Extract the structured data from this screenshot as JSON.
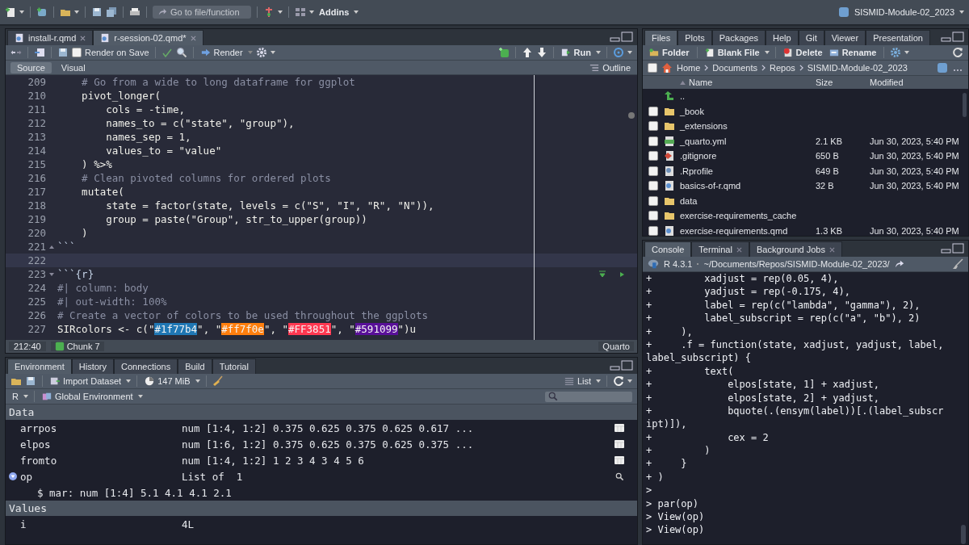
{
  "toolbar": {
    "goto_placeholder": "Go to file/function",
    "addins": "Addins",
    "project": "SISMID-Module-02_2023"
  },
  "editor": {
    "tabs": [
      {
        "label": "install-r.qmd",
        "selected": false
      },
      {
        "label": "r-session-02.qmd*",
        "selected": true
      }
    ],
    "render_on_save": {
      "label": "Render on Save",
      "checked": false
    },
    "render": "Render",
    "run": "Run",
    "modes": [
      {
        "label": "Source",
        "selected": true
      },
      {
        "label": "Visual",
        "selected": false
      }
    ],
    "outline": "Outline",
    "lines": [
      {
        "number": "209",
        "kind": "comment",
        "text": "    # Go from a wide to long dataframe for ggplot",
        "highlighted": false
      },
      {
        "number": "210",
        "kind": "code",
        "text": "    pivot_longer(",
        "highlighted": false
      },
      {
        "number": "211",
        "kind": "code",
        "text": "        cols = -time,",
        "highlighted": false
      },
      {
        "number": "212",
        "kind": "code",
        "text": "        names_to = c(\"state\", \"group\"),",
        "highlighted": false
      },
      {
        "number": "213",
        "kind": "code",
        "text": "        names_sep = 1,",
        "highlighted": false
      },
      {
        "number": "214",
        "kind": "code",
        "text": "        values_to = \"value\"",
        "highlighted": false
      },
      {
        "number": "215",
        "kind": "code",
        "text": "    ) %>%",
        "highlighted": false
      },
      {
        "number": "216",
        "kind": "comment",
        "text": "    # Clean pivoted columns for ordered plots",
        "highlighted": false
      },
      {
        "number": "217",
        "kind": "code",
        "text": "    mutate(",
        "highlighted": false
      },
      {
        "number": "218",
        "kind": "code",
        "text": "        state = factor(state, levels = c(\"S\", \"I\", \"R\", \"N\")),",
        "highlighted": false
      },
      {
        "number": "219",
        "kind": "code",
        "text": "        group = paste(\"Group\", str_to_upper(group))",
        "highlighted": false
      },
      {
        "number": "220",
        "kind": "code",
        "text": "    )",
        "highlighted": false
      },
      {
        "number": "221",
        "kind": "fence-close",
        "text": "```",
        "highlighted": false
      },
      {
        "number": "222",
        "kind": "blank",
        "highlighted": true
      },
      {
        "number": "223",
        "kind": "fence-open",
        "text": "```{r}",
        "highlighted": false
      },
      {
        "number": "224",
        "kind": "comment",
        "text": "#| column: body",
        "highlighted": false
      },
      {
        "number": "225",
        "kind": "comment",
        "text": "#| out-width: 100%",
        "highlighted": false
      },
      {
        "number": "226",
        "kind": "comment",
        "text": "# Create a vector of colors to be used throughout the ggplots",
        "highlighted": false
      },
      {
        "number": "227",
        "kind": "code",
        "segments": [
          {
            "text": "SIRcolors <- c(\""
          },
          {
            "text": "#1f77b4",
            "color": "#1f77b4"
          },
          {
            "text": "\", \""
          },
          {
            "text": "#ff7f0e",
            "color": "#ff7f0e"
          },
          {
            "text": "\", \""
          },
          {
            "text": "#FF3851",
            "color": "#ff3851"
          },
          {
            "text": "\", \""
          },
          {
            "text": "#591099",
            "color": "#591099"
          },
          {
            "text": "\")u"
          }
        ],
        "highlighted": false
      }
    ],
    "status": {
      "position": "212:40",
      "chunk": "Chunk 7",
      "type": "Quarto"
    }
  },
  "environment": {
    "tabs": [
      {
        "label": "Environment",
        "selected": true
      },
      {
        "label": "History",
        "selected": false
      },
      {
        "label": "Connections",
        "selected": false
      },
      {
        "label": "Build",
        "selected": false
      },
      {
        "label": "Tutorial",
        "selected": false
      }
    ],
    "import": "Import Dataset",
    "memory": "147 MiB",
    "view": "List",
    "language": "R",
    "scope": "Global Environment",
    "sections": [
      {
        "title": "Data",
        "rows": [
          {
            "name": "arrpos",
            "value": "num [1:4, 1:2] 0.375 0.625 0.375 0.625 0.617 ...",
            "kind": "grid"
          },
          {
            "name": "elpos",
            "value": "num [1:6, 1:2] 0.375 0.625 0.375 0.625 0.375 ...",
            "kind": "grid"
          },
          {
            "name": "fromto",
            "value": "num [1:4, 1:2] 1 2 3 4 3 4 5 6",
            "kind": "grid"
          },
          {
            "name": "op",
            "value": "List of  1",
            "kind": "list",
            "expanded": true,
            "children": [
              "$ mar: num [1:4] 5.1 4.1 4.1 2.1"
            ]
          }
        ]
      },
      {
        "title": "Values",
        "rows": [
          {
            "name": "i",
            "value": "4L",
            "kind": "value"
          }
        ]
      }
    ]
  },
  "files": {
    "tabs": [
      {
        "label": "Files",
        "selected": true
      },
      {
        "label": "Plots",
        "selected": false
      },
      {
        "label": "Packages",
        "selected": false
      },
      {
        "label": "Help",
        "selected": false
      },
      {
        "label": "Git",
        "selected": false
      },
      {
        "label": "Viewer",
        "selected": false
      },
      {
        "label": "Presentation",
        "selected": false
      }
    ],
    "actions": [
      {
        "kind": "folder",
        "label": "Folder"
      },
      {
        "kind": "file",
        "label": "Blank File"
      },
      {
        "kind": "delete",
        "label": "Delete"
      },
      {
        "kind": "rename",
        "label": "Rename"
      }
    ],
    "select_all": {
      "checked": false
    },
    "path": [
      "Home",
      "Documents",
      "Repos",
      "SISMID-Module-02_2023"
    ],
    "columns": [
      "Name",
      "Size",
      "Modified"
    ],
    "rows": [
      {
        "kind": "up",
        "name": ".."
      },
      {
        "kind": "folder",
        "name": "_book",
        "checked": false
      },
      {
        "kind": "folder",
        "name": "_extensions",
        "checked": false
      },
      {
        "kind": "yml",
        "name": "_quarto.yml",
        "size": "2.1 KB",
        "modified": "Jun 30, 2023, 5:40 PM",
        "checked": false
      },
      {
        "kind": "git",
        "name": ".gitignore",
        "size": "650 B",
        "modified": "Jun 30, 2023, 5:40 PM",
        "checked": false
      },
      {
        "kind": "config",
        "name": ".Rprofile",
        "size": "649 B",
        "modified": "Jun 30, 2023, 5:40 PM",
        "checked": false
      },
      {
        "kind": "qmd",
        "name": "basics-of-r.qmd",
        "size": "32 B",
        "modified": "Jun 30, 2023, 5:40 PM",
        "checked": false
      },
      {
        "kind": "folder",
        "name": "data",
        "checked": false
      },
      {
        "kind": "folder",
        "name": "exercise-requirements_cache",
        "checked": false
      },
      {
        "kind": "qmd",
        "name": "exercise-requirements.qmd",
        "size": "1.3 KB",
        "modified": "Jun 30, 2023, 5:40 PM",
        "checked": false
      }
    ]
  },
  "console": {
    "tabs": [
      {
        "label": "Console",
        "selected": true,
        "closable": false
      },
      {
        "label": "Terminal",
        "selected": false,
        "closable": true
      },
      {
        "label": "Background Jobs",
        "selected": false,
        "closable": true
      }
    ],
    "version": "R 4.3.1",
    "path": "~/Documents/Repos/SISMID-Module-02_2023/",
    "lines": [
      "+         xadjust = rep(0.05, 4),",
      "+         yadjust = rep(-0.175, 4),",
      "+         label = rep(c(\"lambda\", \"gamma\"), 2),",
      "+         label_subscript = rep(c(\"a\", \"b\"), 2)",
      "+     ),",
      "+     .f = function(state, xadjust, yadjust, label,",
      "label_subscript) {",
      "+         text(",
      "+             elpos[state, 1] + xadjust,",
      "+             elpos[state, 2] + yadjust,",
      "+             bquote(.(ensym(label))[.(label_subscr",
      "ipt)]),",
      "+             cex = 2",
      "+         )",
      "+     }",
      "+ )",
      ">",
      "> par(op)",
      "> View(op)",
      "> View(op)"
    ]
  }
}
